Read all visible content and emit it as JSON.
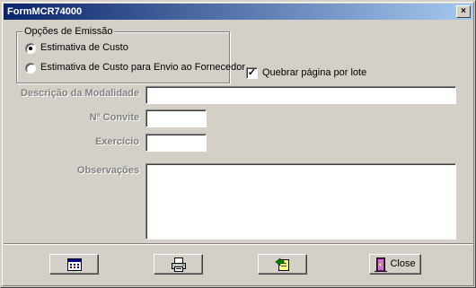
{
  "window": {
    "title": "FormMCR74000",
    "close_glyph": "×"
  },
  "emission": {
    "legend": "Opções de Emissão",
    "options": [
      {
        "label": "Estimativa de Custo",
        "checked": true
      },
      {
        "label": "Estimativa de Custo para Envio ao Fornecedor",
        "checked": false
      }
    ]
  },
  "break_page": {
    "label": "Quebrar página por lote",
    "checked": true,
    "mark": "✓"
  },
  "fields": {
    "descricao": {
      "label": "Descrição da Modalidade",
      "value": ""
    },
    "convite": {
      "label": "Nº Convite",
      "value": ""
    },
    "exercicio": {
      "label": "Exercício",
      "value": ""
    },
    "observacoes": {
      "label": "Observações",
      "value": ""
    }
  },
  "toolbar": {
    "buttons": [
      {
        "icon": "calendar-icon"
      },
      {
        "icon": "printer-icon"
      },
      {
        "icon": "export-icon"
      },
      {
        "icon": "door-exit-icon",
        "label": "Close"
      }
    ]
  },
  "colors": {
    "title_start": "#0a246a",
    "title_end": "#a6caf0",
    "face": "#d4d0c8",
    "disabled_label": "#808080"
  }
}
